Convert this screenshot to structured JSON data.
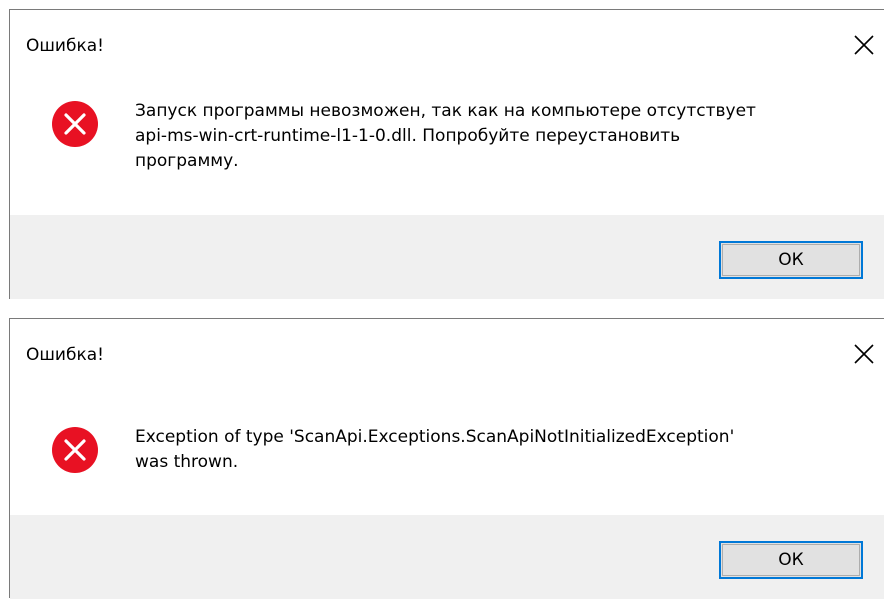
{
  "dialogs": [
    {
      "title": "Ошибка!",
      "message": "Запуск программы невозможен, так как на компьютере отсутствует\napi-ms-win-crt-runtime-l1-1-0.dll. Попробуйте переустановить\nпрограмму.",
      "ok_label": "ОК",
      "icon": "error-icon",
      "close_icon": "close-icon"
    },
    {
      "title": "Ошибка!",
      "message": "Exception of type 'ScanApi.Exceptions.ScanApiNotInitializedException'\nwas thrown.",
      "ok_label": "ОК",
      "icon": "error-icon",
      "close_icon": "close-icon"
    }
  ],
  "colors": {
    "error_red": "#e81123",
    "accent_blue": "#0078d7",
    "footer_gray": "#f0f0f0",
    "button_gray": "#e1e1e1"
  }
}
